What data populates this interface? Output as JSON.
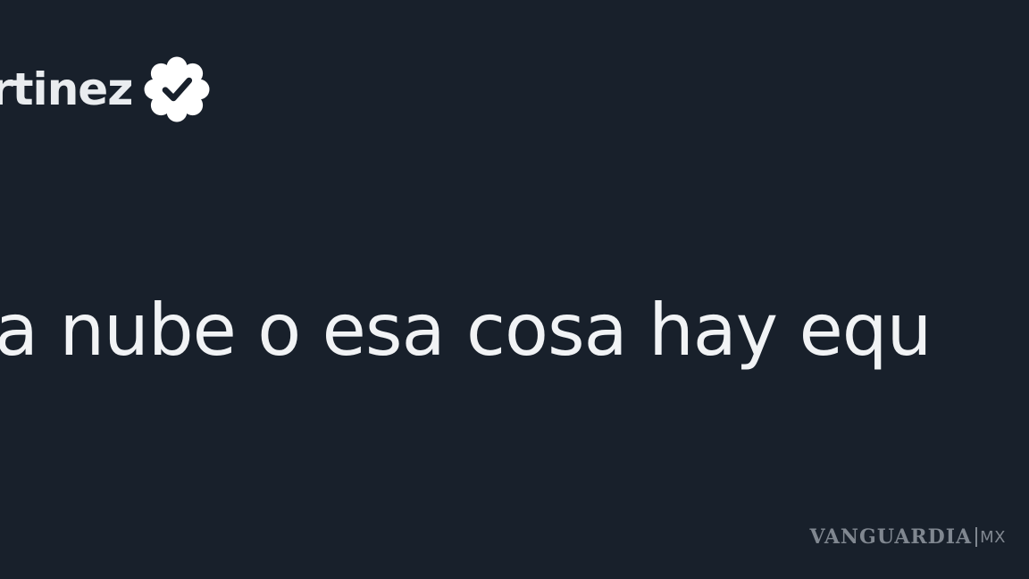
{
  "tweet": {
    "author_name": "rtinez",
    "verified_icon": "verified-badge-icon",
    "text": "a nube o esa cosa hay equ"
  },
  "watermark": {
    "brand": "VANGUARDIA",
    "tld": "MX"
  },
  "colors": {
    "background": "#18202b",
    "text": "#f1f3f5",
    "watermark": "#8c939c"
  }
}
